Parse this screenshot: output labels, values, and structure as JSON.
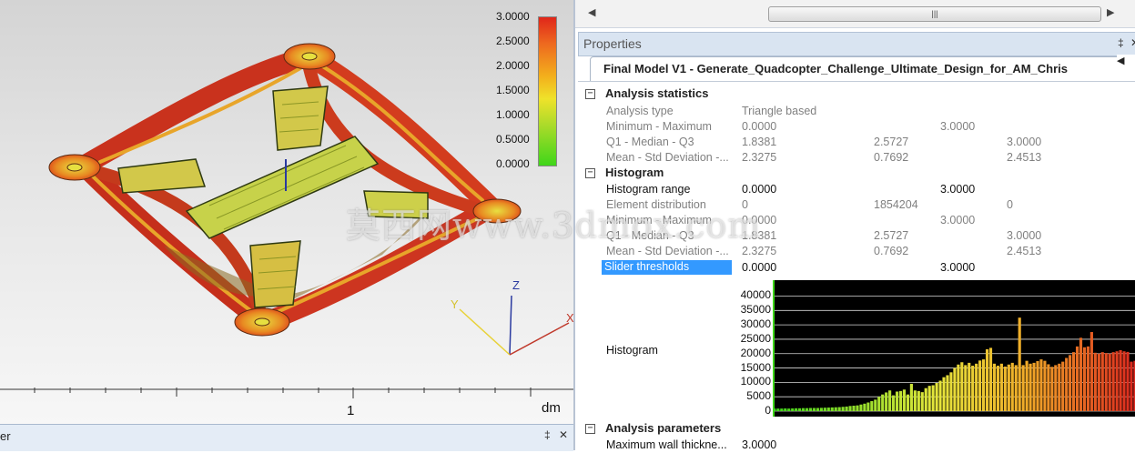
{
  "viewport": {
    "legend": [
      "3.0000",
      "2.5000",
      "2.0000",
      "1.5000",
      "1.0000",
      "0.5000",
      "0.0000"
    ],
    "ruler_label": "1",
    "ruler_unit": "dm",
    "axes": {
      "x": "X",
      "y": "Y",
      "z": "Z"
    },
    "colors": {
      "high": "#e0261a",
      "mid": "#efe22a",
      "low": "#3fd61a"
    }
  },
  "left_dock": {
    "title": "er",
    "pin": "‡",
    "close": "✕"
  },
  "right": {
    "scroll_thumb": "|||",
    "properties_title": "Properties",
    "pin": "‡",
    "close": "✕",
    "tab_title": "Final Model V1 - Generate_Quadcopter_Challenge_Ultimate_Design_for_AM_Chris",
    "tab_nav": "◀",
    "sections": {
      "analysis_statistics": {
        "title": "Analysis statistics",
        "rows": [
          {
            "k": "Analysis type",
            "v1": "Triangle based"
          },
          {
            "k": "Minimum - Maximum",
            "v1": "0.0000",
            "v2": "3.0000"
          },
          {
            "k": "Q1 - Median - Q3",
            "v1": "1.8381",
            "v2": "2.5727",
            "v3": "3.0000"
          },
          {
            "k": "Mean - Std Deviation -...",
            "v1": "2.3275",
            "v2": "0.7692",
            "v3": "2.4513"
          }
        ]
      },
      "histogram": {
        "title": "Histogram",
        "rows": [
          {
            "k": "Histogram range",
            "v1": "0.0000",
            "v2": "3.0000"
          },
          {
            "k": "Element distribution",
            "v1": "0",
            "v2": "1854204",
            "v3": "0"
          },
          {
            "k": "Minimum - Maximum",
            "v1": "0.0000",
            "v2": "3.0000"
          },
          {
            "k": "Q1 - Median - Q3",
            "v1": "1.8381",
            "v2": "2.5727",
            "v3": "3.0000"
          },
          {
            "k": "Mean - Std Deviation -...",
            "v1": "2.3275",
            "v2": "0.7692",
            "v3": "2.4513"
          },
          {
            "k": "Slider thresholds",
            "v1": "0.0000",
            "v2": "3.0000"
          }
        ],
        "histogram_label": "Histogram"
      },
      "analysis_parameters": {
        "title": "Analysis parameters",
        "rows": [
          {
            "k": "Maximum wall thickne...",
            "v1": "3.0000"
          }
        ]
      }
    }
  },
  "watermark": "莫西网www.3dmox.com",
  "chart_data": {
    "type": "bar",
    "yticks": [
      "40000",
      "35000",
      "30000",
      "25000",
      "20000",
      "15000",
      "10000",
      "5000",
      "0"
    ],
    "ylim": [
      0,
      43000
    ],
    "values": [
      900,
      900,
      900,
      950,
      900,
      950,
      1000,
      1000,
      1050,
      1050,
      1100,
      1100,
      1100,
      1150,
      1200,
      1250,
      1300,
      1350,
      1400,
      1500,
      1600,
      1800,
      1900,
      2000,
      2300,
      2600,
      3000,
      3500,
      4000,
      5000,
      5800,
      6500,
      7200,
      5500,
      6800,
      7000,
      7500,
      5800,
      9500,
      7200,
      7000,
      6600,
      8000,
      8800,
      9000,
      9800,
      10600,
      11800,
      12500,
      13500,
      15000,
      16200,
      17000,
      16000,
      16800,
      15800,
      16500,
      17600,
      18000,
      21500,
      22000,
      16500,
      15800,
      16500,
      15500,
      16200,
      16800,
      16000,
      32500,
      16000,
      17500,
      16500,
      16800,
      17400,
      18000,
      17500,
      16300,
      15400,
      16000,
      16500,
      17200,
      18500,
      19500,
      20500,
      22500,
      25500,
      22200,
      22500,
      27500,
      20300,
      20000,
      20500,
      20200,
      20000,
      20500,
      20800,
      21200,
      20800,
      20600,
      17200,
      17500
    ]
  }
}
